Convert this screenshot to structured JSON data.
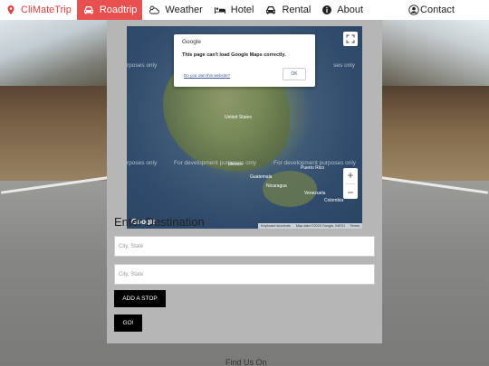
{
  "nav": {
    "brand": "CliMateTrip",
    "roadtrip": "Roadtrip",
    "weather": "Weather",
    "hotel": "Hotel",
    "rental": "Rental",
    "about": "About",
    "contact": "Contact"
  },
  "map": {
    "dialog_title": "Google",
    "dialog_message": "This page can't load Google Maps correctly.",
    "dialog_link": "Do you own this website?",
    "dialog_ok": "OK",
    "watermark": "For development purposes only",
    "watermark_left": "rposes only",
    "watermark_right": "ses only",
    "label_us": "United States",
    "label_mexico": "Mexico",
    "label_guatemala": "Guatemala",
    "label_nicaragua": "Nicaragua",
    "label_venezuela": "Venezuela",
    "label_colombia": "Colombia",
    "label_puerto_rico": "Puerto Rico",
    "google_logo": "Google",
    "attrib_keyboard": "Keyboard shortcuts",
    "attrib_data": "Map data ©2023 Google, INEGI",
    "attrib_terms": "Terms"
  },
  "destination": {
    "title": "Enter Destination",
    "start_placeholder": "City, State",
    "end_placeholder": "City, State",
    "add_stop": "ADD A STOP",
    "go": "GO!"
  },
  "footer": {
    "text": "Find Us On"
  }
}
